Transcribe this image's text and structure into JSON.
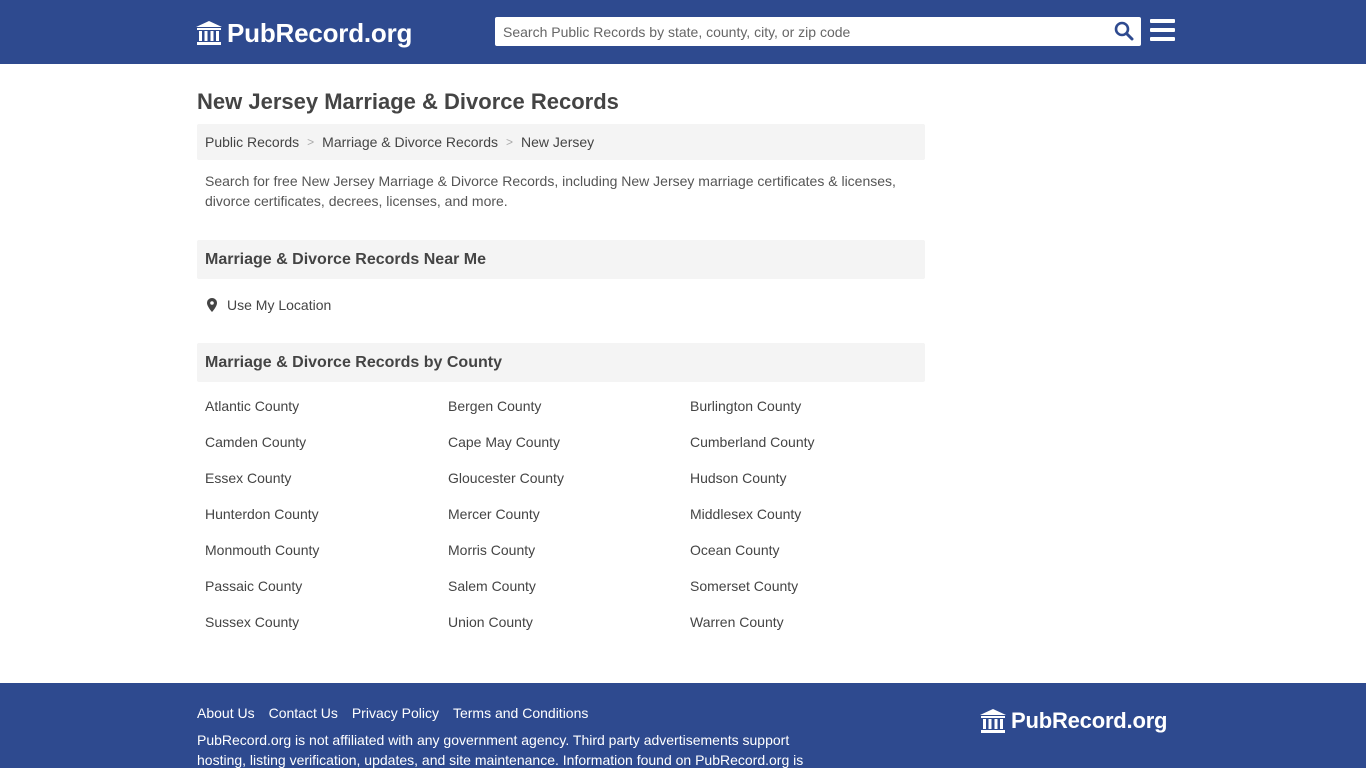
{
  "header": {
    "logo_text": "PubRecord.org",
    "logo_icon": "courthouse-icon",
    "search_placeholder": "Search Public Records by state, county, city, or zip code",
    "search_icon": "search-icon",
    "menu_icon": "hamburger-menu-icon"
  },
  "page": {
    "title": "New Jersey Marriage & Divorce Records",
    "breadcrumb": [
      {
        "label": "Public Records"
      },
      {
        "label": "Marriage & Divorce Records"
      },
      {
        "label": "New Jersey"
      }
    ],
    "breadcrumb_separator": ">",
    "intro": "Search for free New Jersey Marriage & Divorce Records, including New Jersey marriage certificates & licenses, divorce certificates, decrees, licenses, and more."
  },
  "near_me": {
    "heading": "Marriage & Divorce Records Near Me",
    "location_label": "Use My Location",
    "location_icon": "map-marker-icon"
  },
  "by_county": {
    "heading": "Marriage & Divorce Records by County",
    "counties": [
      "Atlantic County",
      "Bergen County",
      "Burlington County",
      "Camden County",
      "Cape May County",
      "Cumberland County",
      "Essex County",
      "Gloucester County",
      "Hudson County",
      "Hunterdon County",
      "Mercer County",
      "Middlesex County",
      "Monmouth County",
      "Morris County",
      "Ocean County",
      "Passaic County",
      "Salem County",
      "Somerset County",
      "Sussex County",
      "Union County",
      "Warren County"
    ]
  },
  "footer": {
    "links": [
      "About Us",
      "Contact Us",
      "Privacy Policy",
      "Terms and Conditions"
    ],
    "disclaimer": "PubRecord.org is not affiliated with any government agency. Third party advertisements support hosting, listing verification, updates, and site maintenance. Information found on PubRecord.org is",
    "logo_text": "PubRecord.org"
  },
  "colors": {
    "brand_blue": "#2e4a8f",
    "search_icon_blue": "#2e4a8f",
    "section_bg": "#f4f4f4",
    "text": "#444444"
  }
}
